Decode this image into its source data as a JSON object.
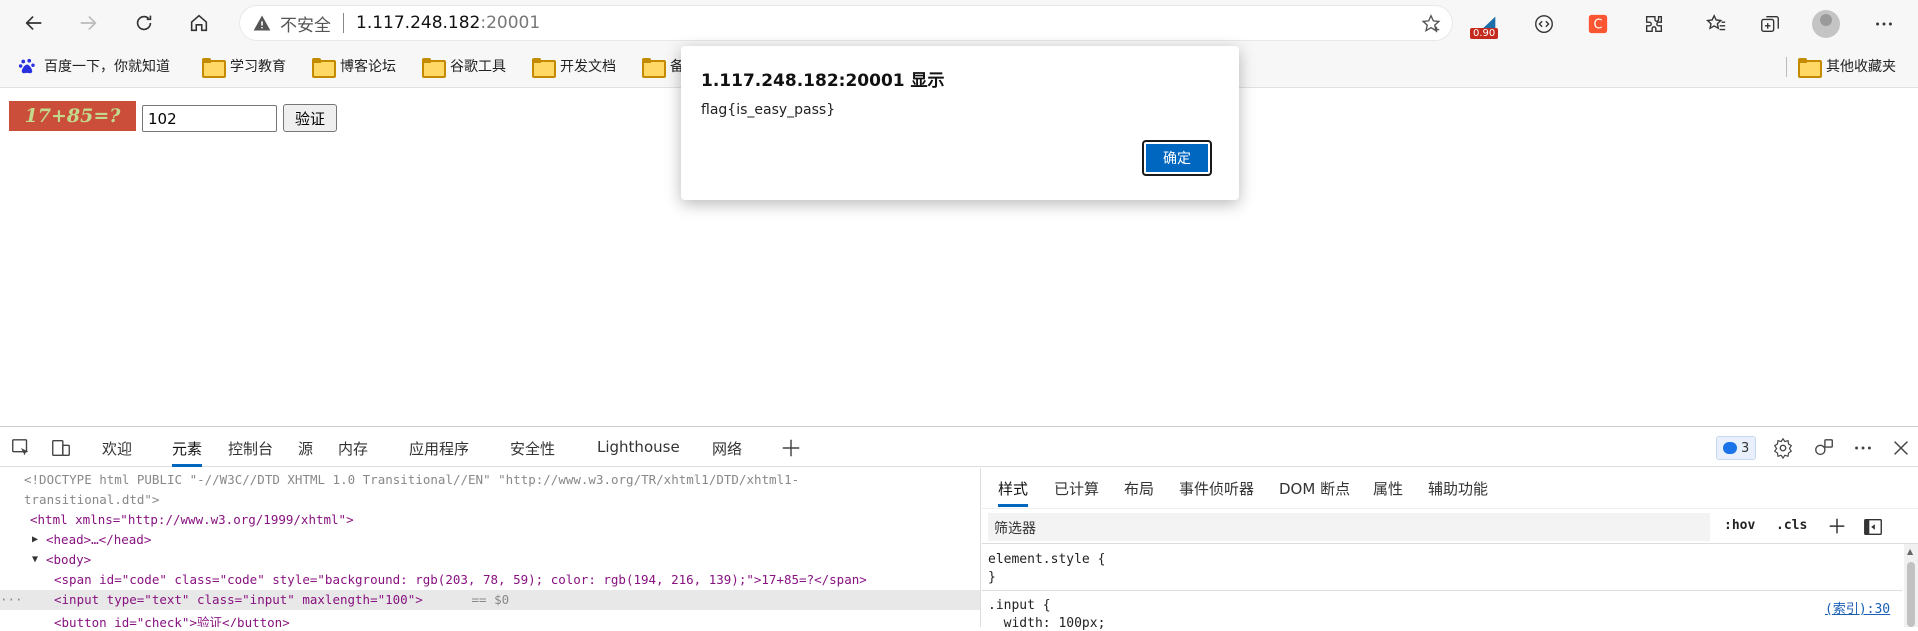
{
  "browser": {
    "address": {
      "security_label": "不安全",
      "host": "1.117.248.182",
      "port": ":20001"
    },
    "extension_badge": "0.90"
  },
  "bookmarks": {
    "items": [
      {
        "label": "百度一下，你就知道",
        "icon": "baidu-icon"
      },
      {
        "label": "学习教育",
        "icon": "folder-icon"
      },
      {
        "label": "博客论坛",
        "icon": "folder-icon"
      },
      {
        "label": "谷歌工具",
        "icon": "folder-icon"
      },
      {
        "label": "开发文档",
        "icon": "folder-icon"
      },
      {
        "label": "备",
        "icon": "folder-icon"
      }
    ],
    "other": "其他收藏夹"
  },
  "page": {
    "captcha_text": "17+85=?",
    "captcha_bg": "#cb4e3b",
    "captcha_fg": "#c2d88b",
    "answer_value": "102",
    "verify_label": "验证"
  },
  "dialog": {
    "title": "1.117.248.182:20001 显示",
    "message": "flag{is_easy_pass}",
    "ok_label": "确定"
  },
  "devtools": {
    "tabs": [
      "欢迎",
      "元素",
      "控制台",
      "源",
      "内存",
      "应用程序",
      "安全性",
      "Lighthouse",
      "网络"
    ],
    "active_tab": "元素",
    "issues_count": "3",
    "dom": {
      "doctype_1": "<!DOCTYPE html PUBLIC \"-//W3C//DTD XHTML 1.0 Transitional//EN\" \"http://www.w3.org/TR/xhtml1/DTD/xhtml1-",
      "doctype_2": "transitional.dtd\">",
      "html_open": "<html xmlns=\"http://www.w3.org/1999/xhtml\">",
      "head": "<head>…</head>",
      "body": "<body>",
      "span": "<span id=\"code\" class=\"code\" style=\"background: rgb(203, 78, 59); color: rgb(194, 216, 139);\">17+85=?</span>",
      "input": "<input type=\"text\" class=\"input\" maxlength=\"100\">",
      "input_suffix": " == $0",
      "button": "<button id=\"check\">验证</button>",
      "ellipsis": "···"
    },
    "styles": {
      "tabs": [
        "样式",
        "已计算",
        "布局",
        "事件侦听器",
        "DOM 断点",
        "属性",
        "辅助功能"
      ],
      "filter_placeholder": "筛选器",
      "hov": ":hov",
      "cls": ".cls",
      "element_style_open": "element.style {",
      "element_style_close": "}",
      "input_rule": ".input {",
      "input_rule_next": "  width: 100px;",
      "input_rule_source": "(索引):30"
    }
  }
}
